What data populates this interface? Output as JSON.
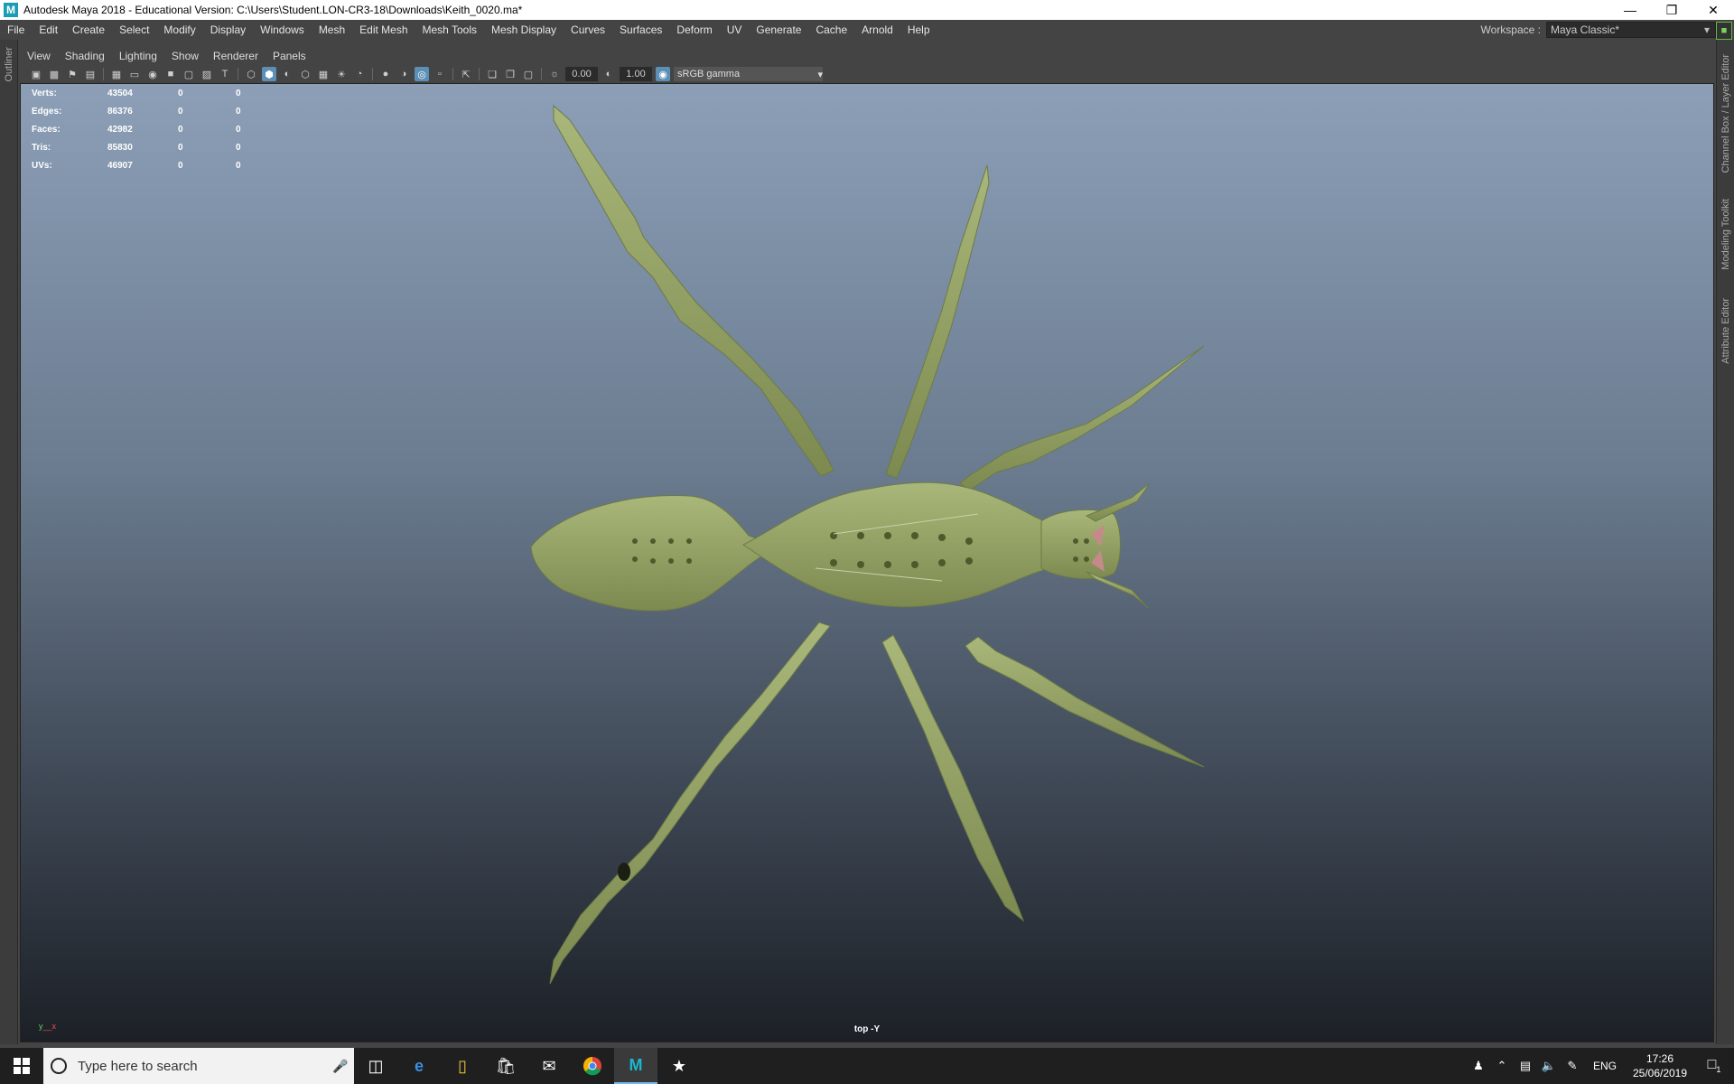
{
  "window": {
    "title": "Autodesk Maya 2018 - Educational Version: C:\\Users\\Student.LON-CR3-18\\Downloads\\Keith_0020.ma*",
    "app_icon": "M"
  },
  "menubar": [
    "File",
    "Edit",
    "Create",
    "Select",
    "Modify",
    "Display",
    "Windows",
    "Mesh",
    "Edit Mesh",
    "Mesh Tools",
    "Mesh Display",
    "Curves",
    "Surfaces",
    "Deform",
    "UV",
    "Generate",
    "Cache",
    "Arnold",
    "Help"
  ],
  "workspace": {
    "label": "Workspace :",
    "value": "Maya Classic*"
  },
  "side_tabs": {
    "left": "Outliner",
    "right_1": "Channel Box / Layer Editor",
    "right_2": "Modeling Toolkit",
    "right_3": "Attribute Editor"
  },
  "panel_menu": [
    "View",
    "Shading",
    "Lighting",
    "Show",
    "Renderer",
    "Panels"
  ],
  "toolbar": {
    "exposure": "0.00",
    "gamma": "1.00",
    "color_space": "sRGB gamma"
  },
  "hud": {
    "rows": [
      {
        "label": "Verts:",
        "v1": "43504",
        "v2": "0",
        "v3": "0"
      },
      {
        "label": "Edges:",
        "v1": "86376",
        "v2": "0",
        "v3": "0"
      },
      {
        "label": "Faces:",
        "v1": "42982",
        "v2": "0",
        "v3": "0"
      },
      {
        "label": "Tris:",
        "v1": "85830",
        "v2": "0",
        "v3": "0"
      },
      {
        "label": "UVs:",
        "v1": "46907",
        "v2": "0",
        "v3": "0"
      }
    ]
  },
  "viewport": {
    "camera_label": "top -Y",
    "axis_y": "y",
    "axis_x": "x",
    "mesh_color": "#9aa86b",
    "bg_top": "#8c9fb7",
    "bg_bottom": "#1c2026"
  },
  "taskbar": {
    "search_placeholder": "Type here to search",
    "language": "ENG",
    "time": "17:26",
    "date": "25/06/2019",
    "notifications": "1"
  }
}
